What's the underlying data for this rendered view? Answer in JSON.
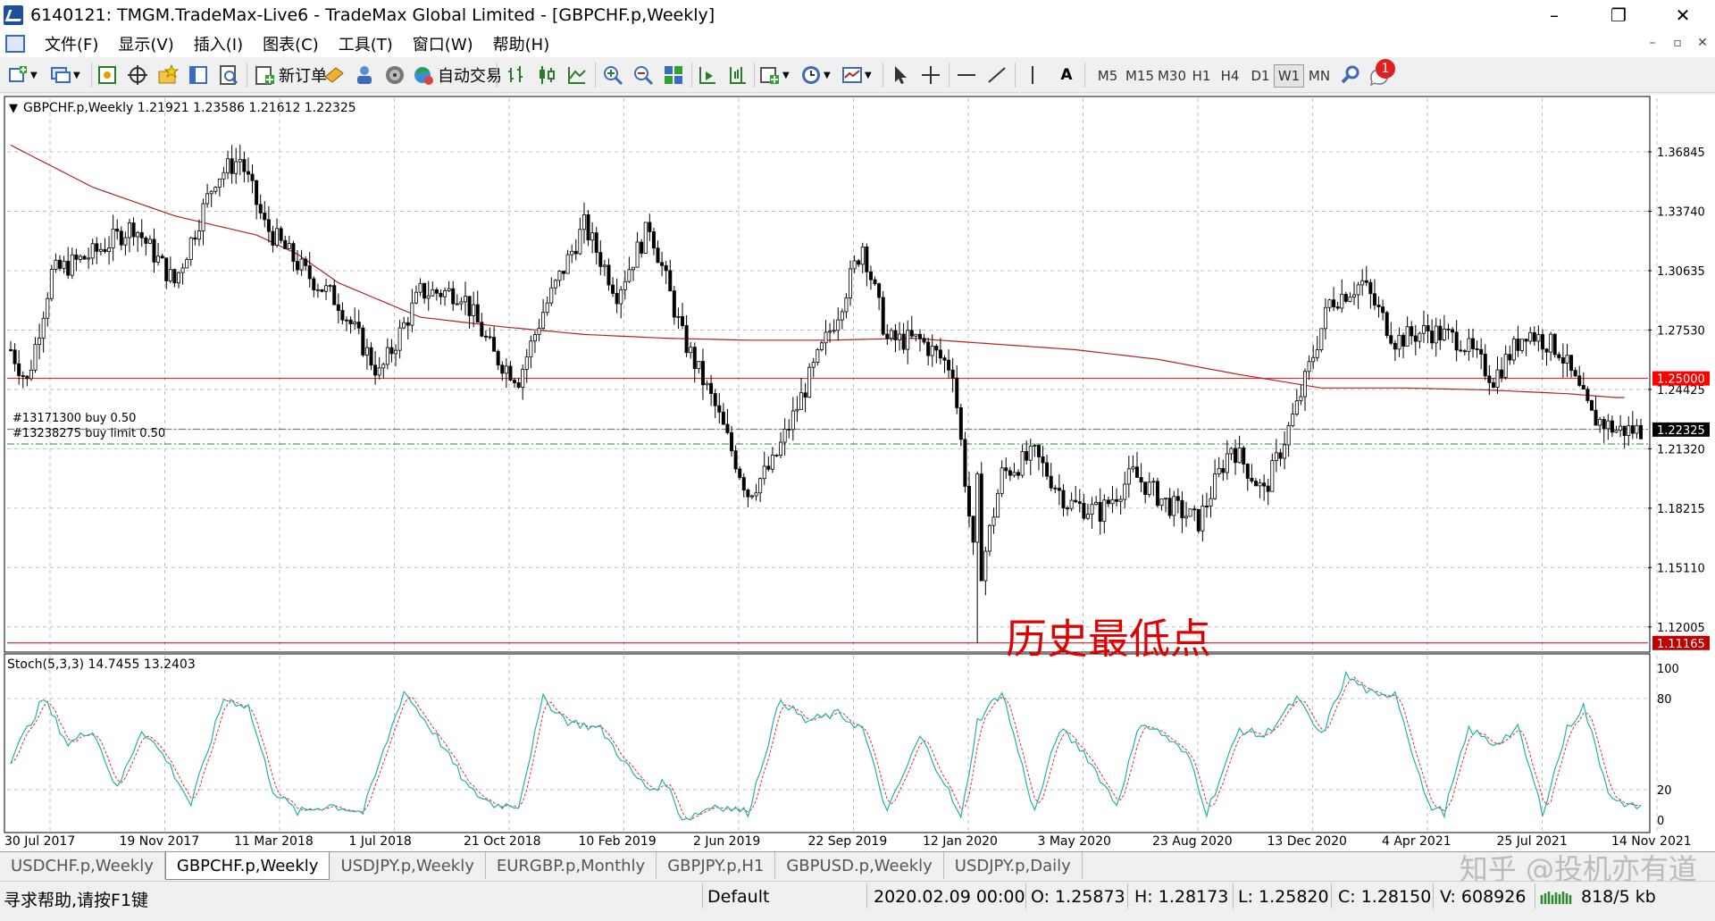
{
  "window": {
    "title": "6140121: TMGM.TradeMax-Live6 - TradeMax Global Limited - [GBPCHF.p,Weekly]",
    "minimize": "–",
    "restore": "❐",
    "close": "✕"
  },
  "menu": {
    "items": [
      "文件(F)",
      "显示(V)",
      "插入(I)",
      "图表(C)",
      "工具(T)",
      "窗口(W)",
      "帮助(H)"
    ],
    "mdi": [
      "–",
      "▫",
      "✕"
    ]
  },
  "toolbar": {
    "new_order": "新订单",
    "auto_trading": "自动交易",
    "text_tool": "A",
    "timeframes": [
      "M5",
      "M15",
      "M30",
      "H1",
      "H4",
      "D1",
      "W1",
      "MN"
    ],
    "active_timeframe": "W1",
    "notification_count": "1"
  },
  "chart": {
    "header": "GBPCHF.p,Weekly  1.21921 1.23586 1.21612 1.22325",
    "price_labels": [
      "1.36845",
      "1.33740",
      "1.30635",
      "1.27530",
      "1.24425",
      "1.21320",
      "1.18215",
      "1.15110",
      "1.12005"
    ],
    "price_ticks": [
      1.36845,
      1.3374,
      1.30635,
      1.2753,
      1.24425,
      1.2132,
      1.18215,
      1.1511,
      1.12005
    ],
    "price_range": [
      1.1078,
      1.3965
    ],
    "marker_level": {
      "label": "1.25000",
      "value": 1.25,
      "color": "#ff0000"
    },
    "current_price": {
      "label": "1.22325",
      "value": 1.22325
    },
    "low_level": {
      "label": "1.11165",
      "value": 1.11165,
      "color": "#c00000"
    },
    "orders": [
      {
        "text": "#13171300 buy 0.50",
        "value": 1.2235
      },
      {
        "text": "#13238275 buy limit 0.50",
        "value": 1.2157
      }
    ],
    "annotation": "历史最低点",
    "annotation_color": "#e00000",
    "moving_average_color": "#b22222",
    "date_labels": [
      "30 Jul 2017",
      "19 Nov 2017",
      "11 Mar 2018",
      "1 Jul 2018",
      "21 Oct 2018",
      "10 Feb 2019",
      "2 Jun 2019",
      "22 Sep 2019",
      "12 Jan 2020",
      "3 May 2020",
      "23 Aug 2020",
      "13 Dec 2020",
      "4 Apr 2021",
      "25 Jul 2021",
      "14 Nov 2021"
    ]
  },
  "stoch": {
    "header": "Stoch(5,3,3) 14.7455 13.2403",
    "levels": [
      "100",
      "80",
      "20",
      "0"
    ],
    "main_color": "#20b2aa",
    "signal_color": "#e03030"
  },
  "chart_data": {
    "type": "candlestick",
    "symbol": "GBPCHF.p",
    "timeframe": "Weekly",
    "x_range": [
      "30 Jul 2017",
      "Nov 2021"
    ],
    "price_anchor_path": [
      [
        0,
        1.265
      ],
      [
        4,
        1.248
      ],
      [
        10,
        1.305
      ],
      [
        20,
        1.315
      ],
      [
        30,
        1.33
      ],
      [
        40,
        1.3
      ],
      [
        50,
        1.355
      ],
      [
        56,
        1.365
      ],
      [
        62,
        1.33
      ],
      [
        72,
        1.305
      ],
      [
        80,
        1.29
      ],
      [
        90,
        1.252
      ],
      [
        100,
        1.295
      ],
      [
        110,
        1.295
      ],
      [
        118,
        1.262
      ],
      [
        124,
        1.25
      ],
      [
        130,
        1.285
      ],
      [
        140,
        1.33
      ],
      [
        148,
        1.295
      ],
      [
        156,
        1.33
      ],
      [
        164,
        1.272
      ],
      [
        172,
        1.235
      ],
      [
        180,
        1.19
      ],
      [
        186,
        1.205
      ],
      [
        194,
        1.245
      ],
      [
        202,
        1.285
      ],
      [
        208,
        1.32
      ],
      [
        214,
        1.27
      ],
      [
        222,
        1.27
      ],
      [
        230,
        1.255
      ],
      [
        236,
        1.14
      ],
      [
        242,
        1.2
      ],
      [
        250,
        1.21
      ],
      [
        258,
        1.185
      ],
      [
        266,
        1.18
      ],
      [
        274,
        1.2
      ],
      [
        282,
        1.185
      ],
      [
        290,
        1.175
      ],
      [
        298,
        1.215
      ],
      [
        306,
        1.19
      ],
      [
        314,
        1.235
      ],
      [
        322,
        1.29
      ],
      [
        330,
        1.3
      ],
      [
        338,
        1.27
      ],
      [
        346,
        1.275
      ],
      [
        354,
        1.27
      ],
      [
        362,
        1.25
      ],
      [
        370,
        1.275
      ],
      [
        378,
        1.265
      ],
      [
        386,
        1.23
      ],
      [
        392,
        1.223
      ]
    ],
    "moving_average_anchors": [
      [
        0,
        1.372
      ],
      [
        20,
        1.35
      ],
      [
        40,
        1.335
      ],
      [
        60,
        1.325
      ],
      [
        70,
        1.315
      ],
      [
        80,
        1.3
      ],
      [
        100,
        1.282
      ],
      [
        120,
        1.277
      ],
      [
        140,
        1.273
      ],
      [
        160,
        1.271
      ],
      [
        180,
        1.27
      ],
      [
        200,
        1.27
      ],
      [
        220,
        1.271
      ],
      [
        240,
        1.268
      ],
      [
        260,
        1.265
      ],
      [
        280,
        1.26
      ],
      [
        300,
        1.252
      ],
      [
        320,
        1.245
      ],
      [
        340,
        1.245
      ],
      [
        360,
        1.244
      ],
      [
        380,
        1.242
      ],
      [
        392,
        1.24
      ]
    ],
    "stoch_anchors": [
      [
        0,
        40
      ],
      [
        8,
        80
      ],
      [
        14,
        50
      ],
      [
        20,
        60
      ],
      [
        26,
        20
      ],
      [
        32,
        60
      ],
      [
        38,
        40
      ],
      [
        44,
        10
      ],
      [
        52,
        80
      ],
      [
        58,
        75
      ],
      [
        64,
        20
      ],
      [
        70,
        5
      ],
      [
        78,
        10
      ],
      [
        86,
        5
      ],
      [
        96,
        85
      ],
      [
        104,
        55
      ],
      [
        112,
        20
      ],
      [
        118,
        10
      ],
      [
        124,
        10
      ],
      [
        130,
        80
      ],
      [
        136,
        65
      ],
      [
        144,
        60
      ],
      [
        152,
        30
      ],
      [
        156,
        20
      ],
      [
        160,
        25
      ],
      [
        164,
        0
      ],
      [
        172,
        10
      ],
      [
        180,
        5
      ],
      [
        188,
        80
      ],
      [
        194,
        65
      ],
      [
        202,
        70
      ],
      [
        208,
        60
      ],
      [
        214,
        5
      ],
      [
        222,
        55
      ],
      [
        228,
        25
      ],
      [
        232,
        0
      ],
      [
        236,
        65
      ],
      [
        242,
        85
      ],
      [
        250,
        5
      ],
      [
        256,
        60
      ],
      [
        262,
        45
      ],
      [
        270,
        10
      ],
      [
        276,
        65
      ],
      [
        282,
        55
      ],
      [
        288,
        40
      ],
      [
        292,
        5
      ],
      [
        300,
        60
      ],
      [
        306,
        55
      ],
      [
        314,
        80
      ],
      [
        320,
        55
      ],
      [
        326,
        95
      ],
      [
        334,
        80
      ],
      [
        338,
        85
      ],
      [
        346,
        10
      ],
      [
        350,
        5
      ],
      [
        356,
        60
      ],
      [
        362,
        50
      ],
      [
        368,
        60
      ],
      [
        374,
        5
      ],
      [
        380,
        60
      ],
      [
        384,
        75
      ],
      [
        390,
        20
      ],
      [
        394,
        8
      ],
      [
        398,
        10
      ]
    ]
  },
  "tabs": [
    "USDCHF.p,Weekly",
    "GBPCHF.p,Weekly",
    "USDJPY.p,Weekly",
    "EURGBP.p,Monthly",
    "GBPJPY.p,H1",
    "GBPUSD.p,Weekly",
    "USDJPY.p,Daily"
  ],
  "active_tab": "GBPCHF.p,Weekly",
  "watermark": "知乎 @投机亦有道",
  "status": {
    "help": "寻求帮助,请按F1键",
    "profile": "Default",
    "datetime": "2020.02.09 00:00",
    "open": "O: 1.25873",
    "high": "H: 1.28173",
    "low": "L: 1.25820",
    "close": "C: 1.28150",
    "volume": "V: 608926",
    "traffic": "818/5 kb"
  }
}
